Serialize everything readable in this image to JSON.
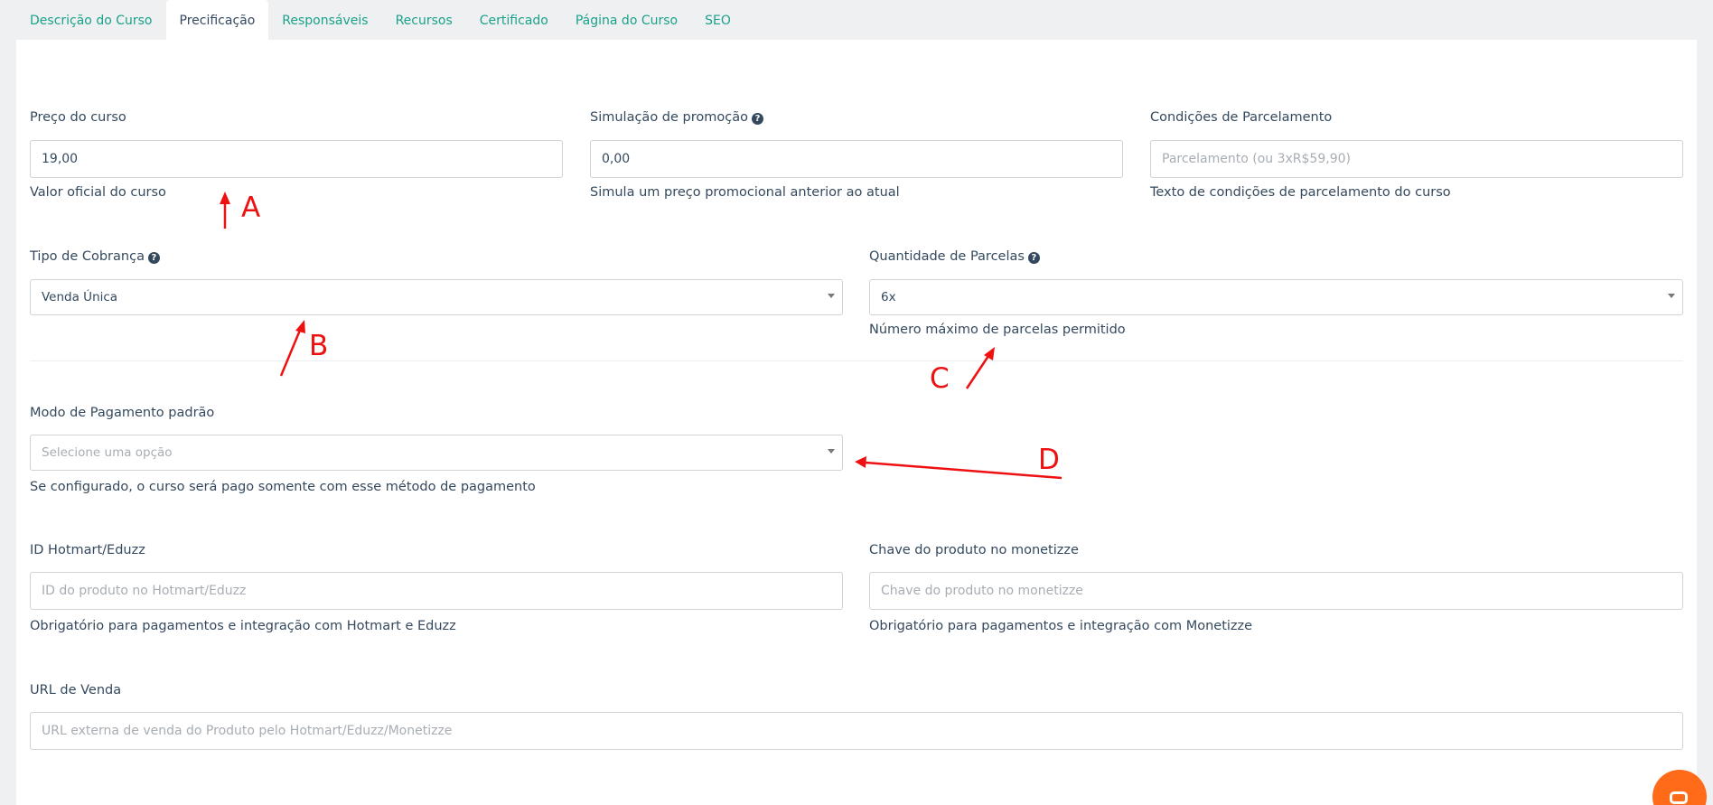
{
  "tabs": [
    {
      "label": "Descrição do Curso",
      "active": false
    },
    {
      "label": "Precificação",
      "active": true
    },
    {
      "label": "Responsáveis",
      "active": false
    },
    {
      "label": "Recursos",
      "active": false
    },
    {
      "label": "Certificado",
      "active": false
    },
    {
      "label": "Página do Curso",
      "active": false
    },
    {
      "label": "SEO",
      "active": false
    }
  ],
  "form": {
    "preco": {
      "label": "Preço do curso",
      "value": "19,00",
      "help": "Valor oficial do curso"
    },
    "simulacao": {
      "label": "Simulação de promoção",
      "value": "0,00",
      "help": "Simula um preço promocional anterior ao atual"
    },
    "condicoes": {
      "label": "Condições de Parcelamento",
      "placeholder": "Parcelamento (ou 3xR$59,90)",
      "help": "Texto de condições de parcelamento do curso"
    },
    "tipo_cobranca": {
      "label": "Tipo de Cobrança",
      "selected": "Venda Única"
    },
    "quantidade_parcelas": {
      "label": "Quantidade de Parcelas",
      "selected": "6x",
      "help": "Número máximo de parcelas permitido"
    },
    "modo_pagamento": {
      "label": "Modo de Pagamento padrão",
      "placeholder": "Selecione uma opção",
      "help": "Se configurado, o curso será pago somente com esse método de pagamento"
    },
    "id_hotmart": {
      "label": "ID Hotmart/Eduzz",
      "placeholder": "ID do produto no Hotmart/Eduzz",
      "help": "Obrigatório para pagamentos e integração com Hotmart e Eduzz"
    },
    "chave_monetizze": {
      "label": "Chave do produto no monetizze",
      "placeholder": "Chave do produto no monetizze",
      "help": "Obrigatório para pagamentos e integração com Monetizze"
    },
    "url_venda": {
      "label": "URL de Venda",
      "placeholder": "URL externa de venda do Produto pelo Hotmart/Eduzz/Monetizze"
    }
  },
  "annotations": {
    "a": "A",
    "b": "B",
    "c": "C",
    "d": "D",
    "color": "#ee1111"
  },
  "colors": {
    "accent": "#1ba18a",
    "text": "#34495e",
    "chat": "#ff6b18"
  },
  "icons": {
    "help": "question-circle-icon",
    "chat": "chat-icon",
    "dropdown": "caret-down-icon"
  }
}
